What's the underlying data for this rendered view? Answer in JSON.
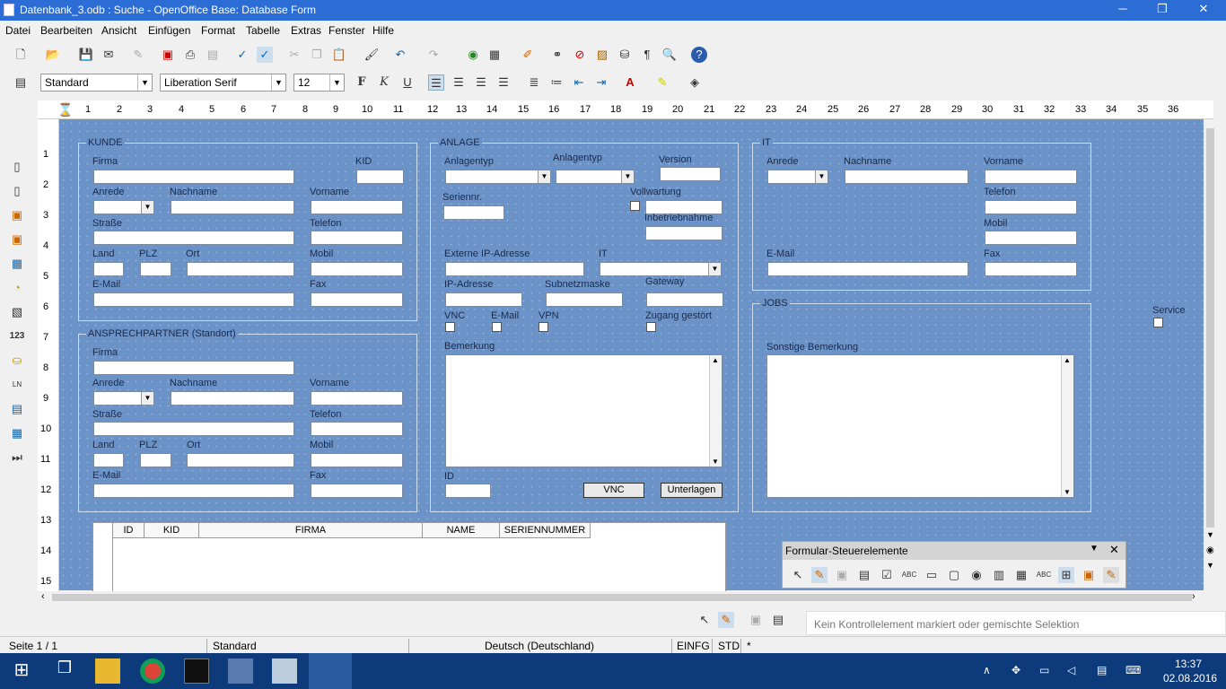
{
  "window": {
    "title": "Datenbank_3.odb : Suche - OpenOffice Base: Database Form",
    "minimize": "─",
    "restore": "❐",
    "close": "✕"
  },
  "menu": [
    "Datei",
    "Bearbeiten",
    "Ansicht",
    "Einfügen",
    "Format",
    "Tabelle",
    "Extras",
    "Fenster",
    "Hilfe"
  ],
  "format": {
    "style": "Standard",
    "font": "Liberation Serif",
    "size": "12"
  },
  "ruler_marks": [
    "1",
    "2",
    "3",
    "4",
    "5",
    "6",
    "7",
    "8",
    "9",
    "10",
    "11",
    "12",
    "13",
    "14",
    "15",
    "16",
    "17",
    "18",
    "19",
    "20",
    "21",
    "22",
    "23",
    "24",
    "25",
    "26",
    "27",
    "28",
    "29",
    "30",
    "31",
    "32",
    "33",
    "34",
    "35",
    "36"
  ],
  "vruler_marks": [
    "1",
    "2",
    "3",
    "4",
    "5",
    "6",
    "7",
    "8",
    "9",
    "10",
    "11",
    "12",
    "13",
    "14",
    "15"
  ],
  "kunde": {
    "title": "KUNDE",
    "firma": "Firma",
    "kid": "KID",
    "anrede": "Anrede",
    "nachname": "Nachname",
    "vorname": "Vorname",
    "strasse": "Straße",
    "telefon": "Telefon",
    "land": "Land",
    "plz": "PLZ",
    "ort": "Ort",
    "mobil": "Mobil",
    "email": "E-Mail",
    "fax": "Fax"
  },
  "ansprech": {
    "title": "ANSPRECHPARTNER (Standort)",
    "firma": "Firma",
    "anrede": "Anrede",
    "nachname": "Nachname",
    "vorname": "Vorname",
    "strasse": "Straße",
    "telefon": "Telefon",
    "land": "Land",
    "plz": "PLZ",
    "ort": "Ort",
    "mobil": "Mobil",
    "email": "E-Mail",
    "fax": "Fax"
  },
  "anlage": {
    "title": "ANLAGE",
    "anlagentyp1": "Anlagentyp",
    "anlagentyp2": "Anlagentyp",
    "version": "Version",
    "seriennr": "Seriennr.",
    "vollwartung": "Vollwartung",
    "inbetrieb": "Inbetriebnahme",
    "extip": "Externe IP-Adresse",
    "it": "IT",
    "ip": "IP-Adresse",
    "subnetz": "Subnetzmaske",
    "gateway": "Gateway",
    "vnc": "VNC",
    "email": "E-Mail",
    "vpn": "VPN",
    "zugang": "Zugang gestört",
    "bemerkung": "Bemerkung",
    "id": "ID",
    "btn_vnc": "VNC",
    "btn_unterlagen": "Unterlagen"
  },
  "it": {
    "title": "IT",
    "anrede": "Anrede",
    "nachname": "Nachname",
    "vorname": "Vorname",
    "telefon": "Telefon",
    "mobil": "Mobil",
    "email": "E-Mail",
    "fax": "Fax"
  },
  "jobs": {
    "title": "JOBS",
    "sonstige": "Sonstige Bemerkung"
  },
  "service": "Service",
  "grid": {
    "columns": [
      "ID",
      "KID",
      "FIRMA",
      "NAME",
      "SERIENNUMMER"
    ]
  },
  "palette": {
    "title": "Formular-Steuerelemente",
    "close": "✕",
    "menu": "▼"
  },
  "tooltip": "Kein Kontrollelement markiert oder gemischte Selektion",
  "status": {
    "page": "Seite 1 / 1",
    "style": "Standard",
    "lang": "Deutsch (Deutschland)",
    "mode": "EINFG",
    "sel": "STD",
    "mod": "*"
  },
  "clock": {
    "time": "13:37",
    "date": "02.08.2016"
  }
}
